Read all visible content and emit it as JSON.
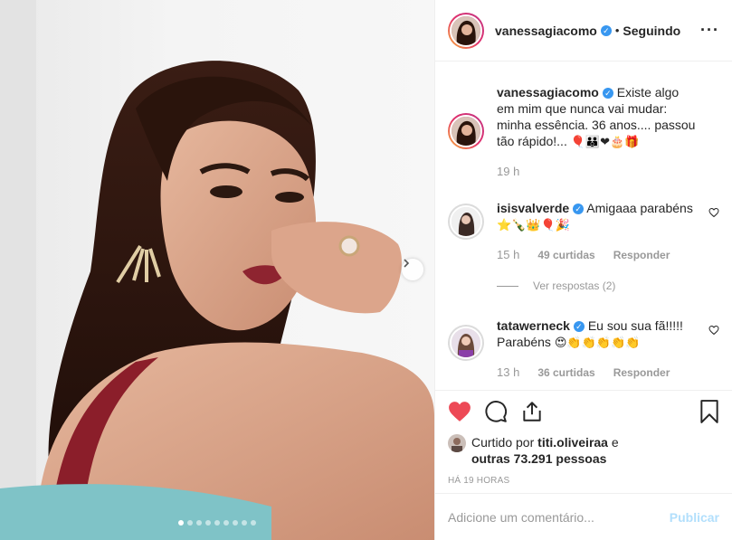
{
  "post": {
    "carousel_dots": 9,
    "carousel_active_index": 0
  },
  "header": {
    "username": "vanessagiacomo",
    "separator": "•",
    "follow_status": "Seguindo",
    "more_icon": "more-horizontal-icon"
  },
  "caption": {
    "username": "vanessagiacomo",
    "text": "Existe algo em mim que nunca vai mudar: minha essência. 36 anos.... passou tão rápido!...",
    "emojis": "🎈👪❤🎂🎁",
    "time": "19 h"
  },
  "comments": [
    {
      "username": "isisvalverde",
      "text": "Amigaaa parabéns",
      "emojis": "⭐🍾👑🎈🎉",
      "time": "15 h",
      "likes": "49 curtidas",
      "reply": "Responder",
      "view_replies": "Ver respostas (2)"
    },
    {
      "username": "tatawerneck",
      "text": "Eu sou sua fã!!!!! Parabéns",
      "emojis": "😍👏👏👏👏👏",
      "time": "13 h",
      "likes": "36 curtidas",
      "reply": "Responder"
    }
  ],
  "actions": {
    "like_icon": "heart-filled-icon",
    "comment_icon": "comment-icon",
    "share_icon": "share-icon",
    "save_icon": "bookmark-icon",
    "liked_by_prefix": "Curtido por",
    "liked_by_user": "titi.oliveiraa",
    "liked_by_and": "e",
    "liked_by_others": "outras 73.291 pessoas",
    "time_ago": "HÁ 19 HORAS"
  },
  "add_comment": {
    "placeholder": "Adicione um comentário...",
    "publish_label": "Publicar"
  },
  "colors": {
    "accent": "#3897f0",
    "like": "#ed4956",
    "publish_disabled": "#b2dffc",
    "muted": "#999999"
  }
}
